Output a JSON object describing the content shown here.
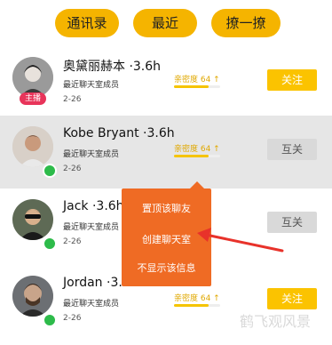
{
  "tabs": [
    {
      "label": "通讯录"
    },
    {
      "label": "最近"
    },
    {
      "label": "撩一撩"
    }
  ],
  "contacts": [
    {
      "name": "奥黛丽赫本 ·3.6h",
      "subtitle": "最近聊天室成员",
      "date": "2-26",
      "intimacy": "亲密度 64 ↑",
      "intimacy_level": 0.75,
      "button": "关注",
      "button_type": "follow",
      "badge": "主播",
      "online": false
    },
    {
      "name": "Kobe Bryant ·3.6h",
      "subtitle": "最近聊天室成员",
      "date": "2-26",
      "intimacy": "亲密度 64 ↑",
      "intimacy_level": 0.75,
      "button": "互关",
      "button_type": "mutual",
      "online": true
    },
    {
      "name": "Jack ·3.6h",
      "subtitle": "最近聊天室成员",
      "date": "2-26",
      "intimacy": "",
      "intimacy_level": null,
      "button": "互关",
      "button_type": "mutual",
      "online": true
    },
    {
      "name": "Jordan ·3.6h",
      "subtitle": "最近聊天室成员",
      "date": "2-26",
      "intimacy": "亲密度 64 ↑",
      "intimacy_level": 0.75,
      "button": "关注",
      "button_type": "follow",
      "online": true
    }
  ],
  "context_menu": {
    "items": [
      "置顶该聊友",
      "创建聊天室",
      "不显示该信息"
    ]
  },
  "watermark": "鹤飞观风景",
  "colors": {
    "accent": "#f5b400",
    "menu": "#ef6b24",
    "annotation_arrow": "#e8322a",
    "online": "#2dbb4a",
    "badge": "#e8345a"
  }
}
